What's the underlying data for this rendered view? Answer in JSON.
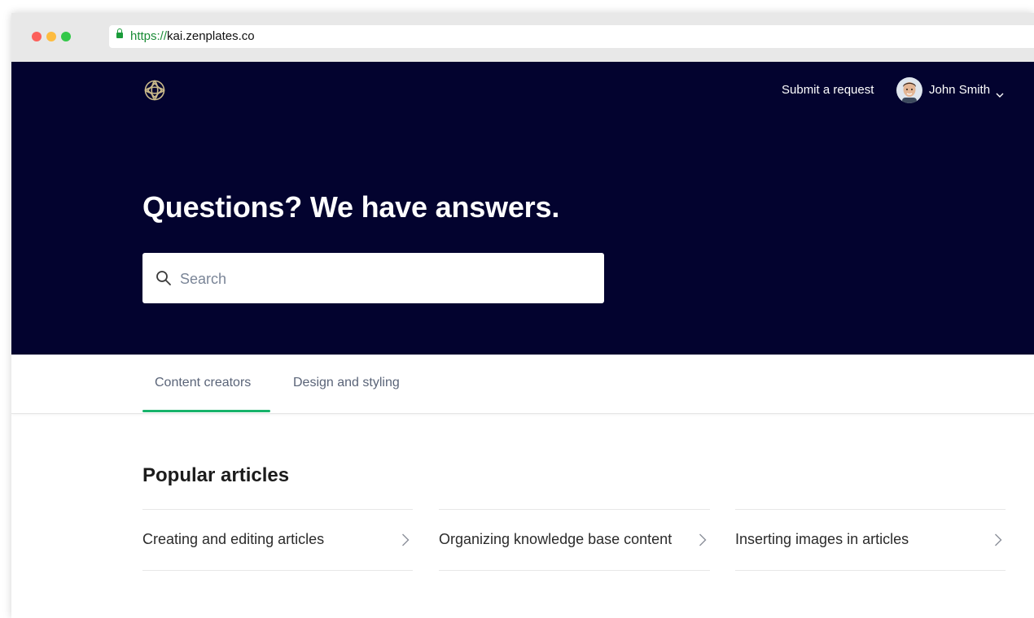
{
  "browser": {
    "url_scheme": "https://",
    "url_host": "kai.zenplates.co"
  },
  "header": {
    "logo_icon": "lotus-logo-icon",
    "submit_label": "Submit a request",
    "user_name": "John Smith",
    "colors": {
      "background": "#03032f",
      "logo": "#c9b98a"
    }
  },
  "hero": {
    "headline": "Questions? We have answers.",
    "search_placeholder": "Search"
  },
  "tabs": [
    {
      "label": "Content creators",
      "active": true
    },
    {
      "label": "Design and styling",
      "active": false
    }
  ],
  "accent_color": "#17b36b",
  "popular": {
    "title": "Popular articles",
    "articles": [
      {
        "label": "Creating and editing articles"
      },
      {
        "label": "Organizing knowledge base content"
      },
      {
        "label": "Inserting images in articles"
      }
    ]
  }
}
